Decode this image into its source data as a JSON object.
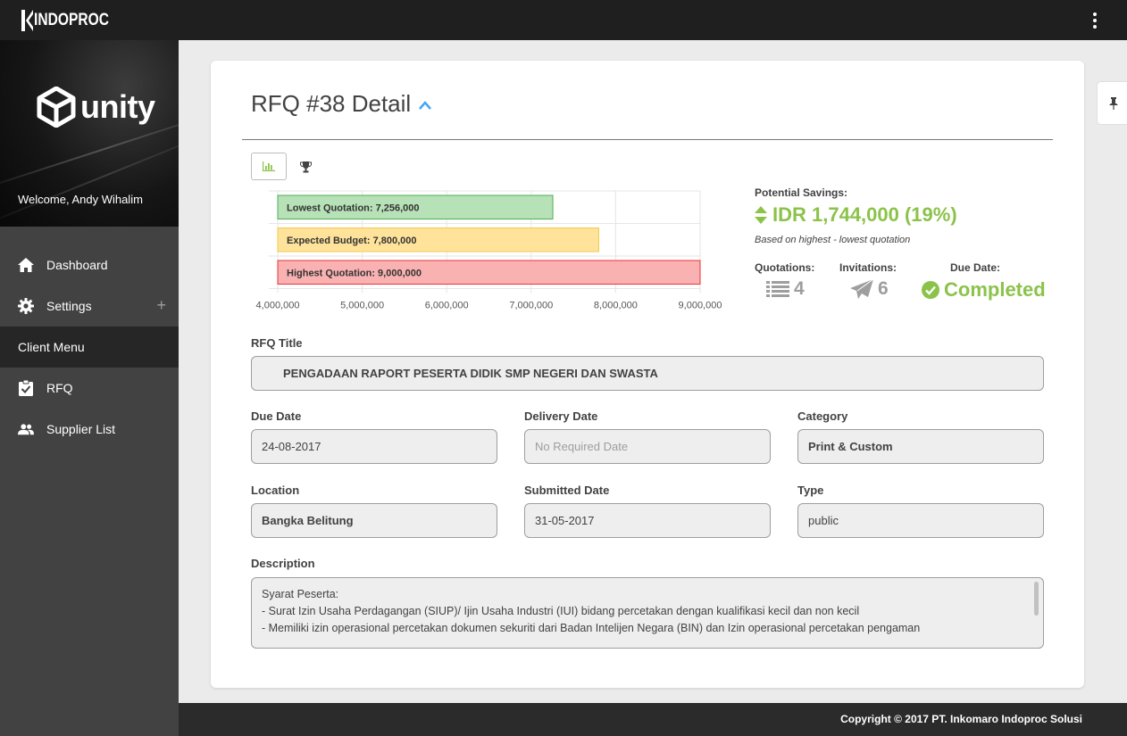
{
  "app": {
    "brand": "INDOPROC"
  },
  "sidebar": {
    "client_brand": "unity",
    "welcome": "Welcome, Andy Wihalim",
    "items": [
      {
        "label": "Dashboard",
        "icon": "home-icon"
      },
      {
        "label": "Settings",
        "icon": "gear-icon"
      }
    ],
    "section_label": "Client Menu",
    "client_items": [
      {
        "label": "RFQ",
        "icon": "clipboard-check-icon"
      },
      {
        "label": "Supplier List",
        "icon": "people-icon"
      }
    ]
  },
  "page": {
    "title": "RFQ #38 Detail"
  },
  "chart_data": {
    "type": "bar",
    "orientation": "horizontal",
    "categories": [
      "Lowest Quotation: 7,256,000",
      "Expected Budget: 7,800,000",
      "Highest Quotation: 9,000,000"
    ],
    "values": [
      7256000,
      7800000,
      9000000
    ],
    "colors": [
      "#b7e1b7",
      "#ffe39a",
      "#f9b1b1"
    ],
    "border_colors": [
      "#4caf50",
      "#f2c94c",
      "#e53935"
    ],
    "xlim": [
      4000000,
      9000000
    ],
    "x_ticks": [
      "4,000,000",
      "5,000,000",
      "6,000,000",
      "7,000,000",
      "8,000,000",
      "9,000,000"
    ],
    "grid": true
  },
  "savings": {
    "label": "Potential Savings:",
    "value": "IDR 1,744,000 (19%)",
    "note": "Based on highest - lowest quotation",
    "accent": "#8bc34a"
  },
  "stats": {
    "quotations": {
      "label": "Quotations:",
      "value": "4"
    },
    "invitations": {
      "label": "Invitations:",
      "value": "6"
    },
    "due": {
      "label": "Due Date:",
      "value": "Completed"
    }
  },
  "form": {
    "rfq_title": {
      "label": "RFQ Title",
      "value": "PENGADAAN RAPORT PESERTA DIDIK SMP NEGERI DAN SWASTA"
    },
    "due_date": {
      "label": "Due Date",
      "value": "24-08-2017"
    },
    "delivery_date": {
      "label": "Delivery Date",
      "value": "No Required Date"
    },
    "category": {
      "label": "Category",
      "value": "Print & Custom"
    },
    "location": {
      "label": "Location",
      "value": "Bangka Belitung"
    },
    "submitted_date": {
      "label": "Submitted Date",
      "value": "31-05-2017"
    },
    "type": {
      "label": "Type",
      "value": "public"
    },
    "description": {
      "label": "Description",
      "lines": [
        "Syarat Peserta:",
        "- Surat Izin Usaha Perdagangan (SIUP)/ Ijin Usaha Industri (IUI) bidang percetakan dengan kualifikasi kecil dan non kecil",
        "- Memiliki izin operasional percetakan dokumen sekuriti dari Badan Intelijen Negara (BIN) dan Izin operasional percetakan pengaman"
      ]
    }
  },
  "footer": {
    "copyright": "Copyright © 2017 PT. Inkomaro Indoproc Solusi"
  }
}
